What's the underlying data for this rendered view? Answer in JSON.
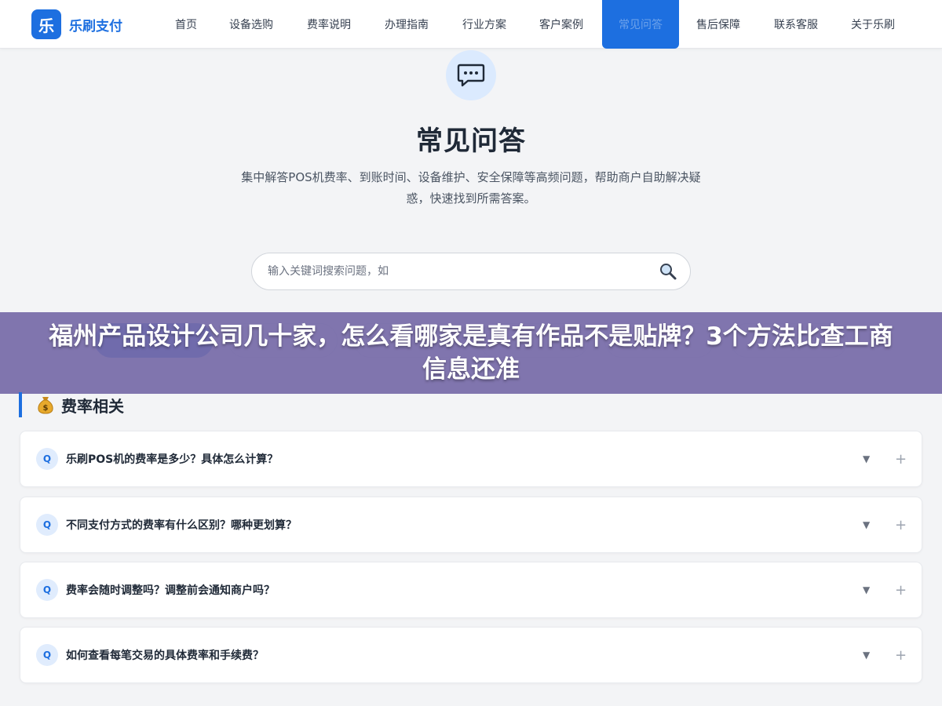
{
  "brand": {
    "mark": "乐",
    "name": "乐刷支付"
  },
  "nav": {
    "items": [
      {
        "label": "首页"
      },
      {
        "label": "设备选购"
      },
      {
        "label": "费率说明"
      },
      {
        "label": "办理指南"
      },
      {
        "label": "行业方案"
      },
      {
        "label": "客户案例"
      },
      {
        "label": "常见问答",
        "active": true
      },
      {
        "label": "售后保障"
      },
      {
        "label": "联系客服"
      },
      {
        "label": "关于乐刷"
      }
    ]
  },
  "hero": {
    "icon": "chat-bubble-icon",
    "title": "常见问答",
    "description": "集中解答POS机费率、到账时间、设备维护、安全保障等高频问题，帮助商户自助解决疑惑，快速找到所需答案。"
  },
  "search": {
    "placeholder": "输入关键词搜索问题，如",
    "icon": "magnifier-icon"
  },
  "banner": {
    "text": "福州产品设计公司几十家，怎么看哪家是真有作品不是贴牌？3个方法比查工商信息还准"
  },
  "section": {
    "icon": "money-bag-icon",
    "title": "费率相关"
  },
  "faqs": [
    {
      "badge": "Q",
      "question": "乐刷POS机的费率是多少？具体怎么计算？",
      "caret": "▼",
      "plus": "+"
    },
    {
      "badge": "Q",
      "question": "不同支付方式的费率有什么区别？哪种更划算？",
      "caret": "▼",
      "plus": "+"
    },
    {
      "badge": "Q",
      "question": "费率会随时调整吗？调整前会通知商户吗？",
      "caret": "▼",
      "plus": "+"
    },
    {
      "badge": "Q",
      "question": "如何查看每笔交易的具体费率和手续费？",
      "caret": "▼",
      "plus": "+"
    }
  ],
  "colors": {
    "primary": "#1d6fe0",
    "banner": "#766aa8",
    "background": "#f3f4f6"
  }
}
